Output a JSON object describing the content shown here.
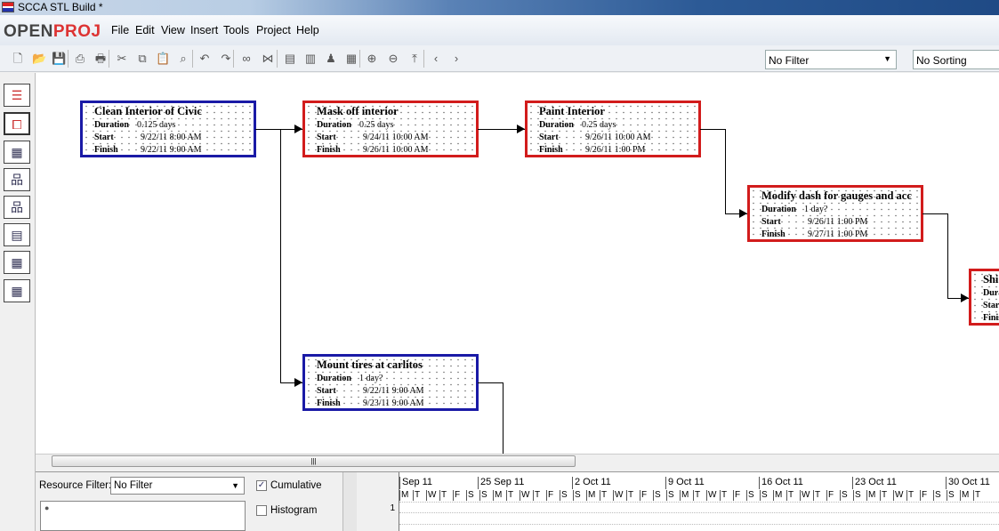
{
  "window": {
    "title": "SCCA STL Build *"
  },
  "menubar": {
    "logo_open": "OPEN",
    "logo_proj": "PROJ",
    "items": [
      "File",
      "Edit",
      "View",
      "Insert",
      "Tools",
      "Project",
      "Help"
    ]
  },
  "toolbar": {
    "icons": [
      "new-icon",
      "open-icon",
      "save-icon",
      "print-icon",
      "print-preview-icon",
      "cut-icon",
      "copy-icon",
      "paste-icon",
      "find-icon",
      "undo-icon",
      "redo-icon",
      "link-icon",
      "unlink-icon",
      "task-info-icon",
      "notes-icon",
      "resource-icon",
      "calendar-icon",
      "zoom-in-icon",
      "zoom-out-icon",
      "scroll-to-task-icon",
      "previous-icon",
      "next-icon"
    ],
    "filter": "No Filter",
    "sorting": "No Sorting"
  },
  "sidebar": {
    "views": [
      "gantt-view",
      "network-view",
      "resource-usage-view",
      "wbs-view",
      "rbs-view",
      "task-usage-view",
      "resource-delete-view",
      "resource-assign-view"
    ]
  },
  "network": {
    "field_labels": {
      "duration": "Duration",
      "start": "Start",
      "finish": "Finish"
    },
    "nodes": [
      {
        "name": "Clean Interior of Civic",
        "duration": "0.125 days",
        "start": "9/22/11 8:00 AM",
        "finish": "9/22/11 9:00 AM",
        "critical": false
      },
      {
        "name": "Mask off interior",
        "duration": "0.25 days",
        "start": "9/24/11 10:00 AM",
        "finish": "9/26/11 10:00 AM",
        "critical": true
      },
      {
        "name": "Paint Interior",
        "duration": "0.25 days",
        "start": "9/26/11 10:00 AM",
        "finish": "9/26/11 1:00 PM",
        "critical": true
      },
      {
        "name": "Modify dash for gauges and acc",
        "duration": "1 day?",
        "start": "9/26/11 1:00 PM",
        "finish": "9/27/11 1:00 PM",
        "critical": true
      },
      {
        "name": "Shi",
        "duration": "",
        "start": "",
        "finish": "",
        "critical": true
      },
      {
        "name": "Mount tires at carlitos",
        "duration": "1 day?",
        "start": "9/22/11 9:00 AM",
        "finish": "9/23/11 9:00 AM",
        "critical": false
      }
    ]
  },
  "colors": {
    "critical": "#d21c1c",
    "noncritical": "#1a1aa6"
  },
  "bottom": {
    "resource_filter_label": "Resource Filter:",
    "resource_filter": "No Filter",
    "cumulative": "Cumulative",
    "cumulative_checked": true,
    "histogram": "Histogram",
    "histogram_checked": false,
    "row_number": "1",
    "weeks": [
      "Sep 11",
      "25 Sep 11",
      "2 Oct 11",
      "9 Oct 11",
      "16 Oct 11",
      "23 Oct 11",
      "30 Oct 11"
    ],
    "days": [
      "M",
      "T",
      "W",
      "T",
      "F",
      "S",
      "S"
    ]
  }
}
